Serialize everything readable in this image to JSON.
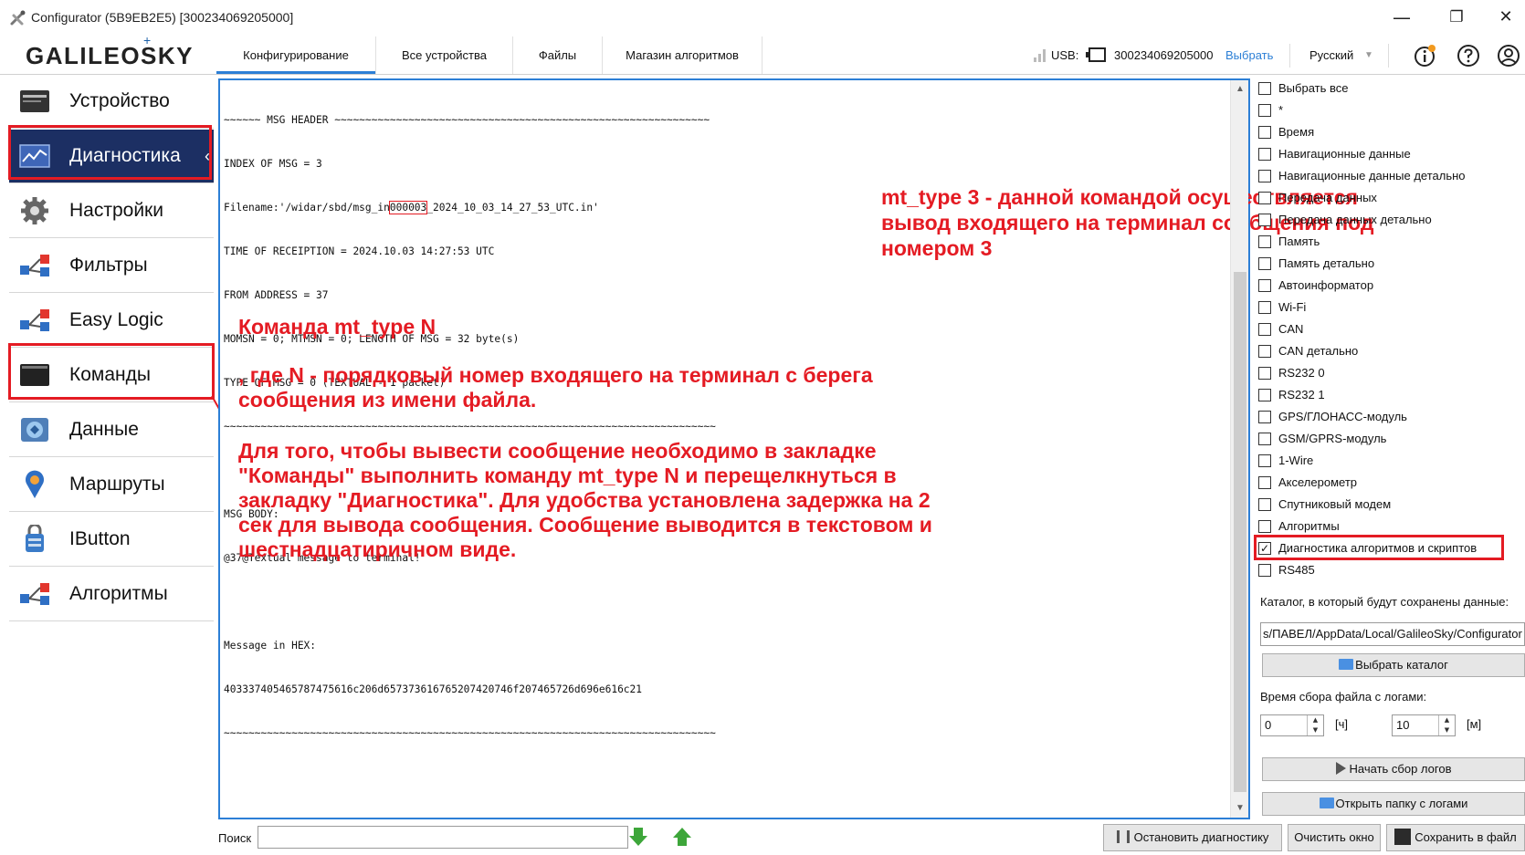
{
  "window": {
    "title": "Configurator  (5B9EB2E5) [300234069205000]",
    "controls": {
      "minimize": "—",
      "restore": "❐",
      "close": "✕"
    }
  },
  "toolbar": {
    "logo": "GALILEOSKY",
    "tabs": [
      {
        "label": "Конфигурирование",
        "active": true
      },
      {
        "label": "Все устройства",
        "active": false
      },
      {
        "label": "Файлы",
        "active": false
      },
      {
        "label": "Магазин алгоритмов",
        "active": false
      }
    ],
    "usb_label": "USB:",
    "serial": "300234069205000",
    "choose_link": "Выбрать",
    "language": "Русский",
    "accent_color": "#2c7fd6"
  },
  "sidebar": {
    "items": [
      {
        "label": "Устройство",
        "icon": "device-icon",
        "active": false
      },
      {
        "label": "Диагностика",
        "icon": "diagnostics-chart-icon",
        "active": true
      },
      {
        "label": "Настройки",
        "icon": "gear-icon",
        "active": false
      },
      {
        "label": "Фильтры",
        "icon": "filters-icon",
        "active": false
      },
      {
        "label": "Easy Logic",
        "icon": "easy-logic-icon",
        "active": false
      },
      {
        "label": "Команды",
        "icon": "commands-terminal-icon",
        "active": false
      },
      {
        "label": "Данные",
        "icon": "data-icon",
        "active": false
      },
      {
        "label": "Маршруты",
        "icon": "map-pin-icon",
        "active": false
      },
      {
        "label": "IButton",
        "icon": "ibutton-icon",
        "active": false
      },
      {
        "label": "Алгоритмы",
        "icon": "algorithms-icon",
        "active": false
      }
    ],
    "active_bg": "#1c2f63"
  },
  "log": {
    "lines": [
      "~~~~~~ MSG HEADER ~~~~~~~~~~~~~~~~~~~~~~~~~~~~~~~~~~~~~~~~~~~~~~~~~~~~~~~~~~~~~",
      "INDEX OF MSG = 3",
      "Filename:'/widar/sbd/msg_in",
      "TIME OF RECEIPTION = 2024.10.03 14:27:53 UTC",
      "FROM ADDRESS = 37",
      "MOMSN = 0; MTMSN = 0; LENGTH OF MSG = 32 byte(s)",
      "TYPE OF MSG = 0 (TEXTUAL - 1 packet)",
      "~~~~~~~~~~~~~~~~~~~~~~~~~~~~~~~~~~~~~~~~~~~~~~~~~~~~~~~~~~~~~~~~~~~~~~~~~~~~~~~~",
      "",
      "MSG BODY:",
      "@37@Textual message to terminal!",
      "",
      "Message in HEX:",
      "403337405465787475616c206d6573736167652074 6f207465726d696e616c21",
      "~~~~~~~~~~~~~~~~~~~~~~~~~~~~~~~~~~~~~~~~~~~~~~~~~~~~~~~~~~~~~~~~~~~~~~~~~~~~~~~~"
    ],
    "filename_highlight": "000003",
    "filename_rest": "_2024_10_03_14_27_53_UTC.in'",
    "hex_line": "403337405465787475616c206d657373616765207420746f207465726d696e616c21"
  },
  "annotations": {
    "top": "mt_type 3  - данной командой осуществляется вывод входящего на терминал сообщения под номером 3",
    "command": "Команда mt_type N",
    "where": ", где N - порядковый номер входящего на терминал с берега сообщения из имени файла.",
    "howto": "Для того, чтобы вывести сообщение необходимо в закладке \"Команды\" выполнить команду mt_type N и перещелкнуться в закладку \"Диагностика\". Для удобства установлена задержка на 2 сек для вывода сообщения. Сообщение выводится в текстовом и шестнадцатиричном виде.",
    "color": "#e41b23"
  },
  "filters": {
    "items": [
      {
        "label": "Выбрать все",
        "checked": false
      },
      {
        "label": "*",
        "checked": false
      },
      {
        "label": "Время",
        "checked": false
      },
      {
        "label": "Навигационные данные",
        "checked": false
      },
      {
        "label": "Навигационные данные детально",
        "checked": false
      },
      {
        "label": "Передача данных",
        "checked": false
      },
      {
        "label": "Передача данных детально",
        "checked": false
      },
      {
        "label": "Память",
        "checked": false
      },
      {
        "label": "Память детально",
        "checked": false
      },
      {
        "label": "Автоинформатор",
        "checked": false
      },
      {
        "label": "Wi-Fi",
        "checked": false
      },
      {
        "label": "CAN",
        "checked": false
      },
      {
        "label": "CAN детально",
        "checked": false
      },
      {
        "label": "RS232 0",
        "checked": false
      },
      {
        "label": "RS232 1",
        "checked": false
      },
      {
        "label": "GPS/ГЛОНАСС-модуль",
        "checked": false
      },
      {
        "label": "GSM/GPRS-модуль",
        "checked": false
      },
      {
        "label": "1-Wire",
        "checked": false
      },
      {
        "label": "Акселерометр",
        "checked": false
      },
      {
        "label": "Спутниковый модем",
        "checked": false
      },
      {
        "label": "Алгоритмы",
        "checked": false
      },
      {
        "label": "Диагностика алгоритмов и скриптов",
        "checked": true
      },
      {
        "label": "RS485",
        "checked": false
      }
    ],
    "check_mark": "✓"
  },
  "settings": {
    "folder_label": "Каталог, в который будут сохранены данные:",
    "folder_path": "s/ПАВЕЛ/AppData/Local/GalileoSky/Configurator",
    "choose_folder": "Выбрать каталог",
    "time_label": "Время сбора файла с логами:",
    "hours_value": "0",
    "hours_unit": "[ч]",
    "minutes_value": "10",
    "minutes_unit": "[м]",
    "start_logs": "Начать сбор логов",
    "open_logs_folder": "Открыть папку с логами"
  },
  "bottom": {
    "search_label": "Поиск",
    "search_value": "",
    "stop_diag": "Остановить диагностику",
    "clear_window": "Очистить окно",
    "save_file": "Сохранить в файл"
  }
}
